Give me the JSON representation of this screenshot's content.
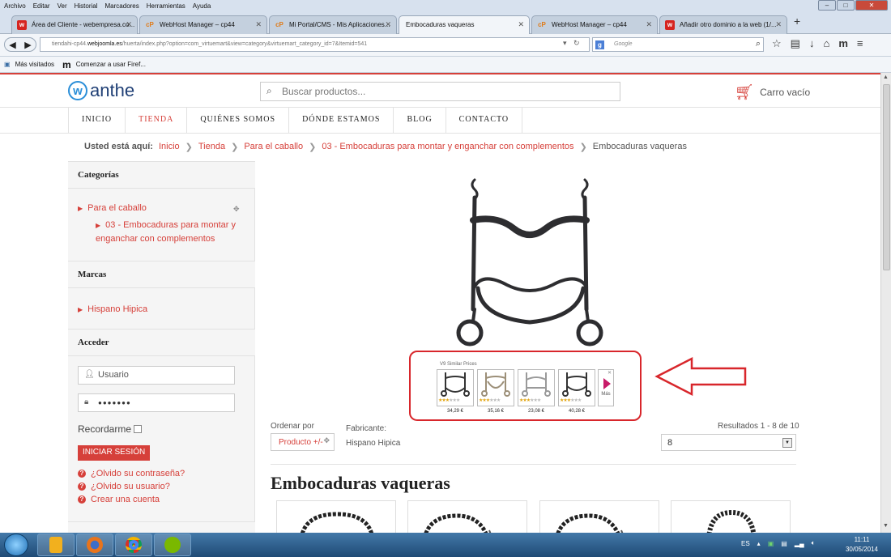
{
  "browser": {
    "menu": [
      "Archivo",
      "Editar",
      "Ver",
      "Historial",
      "Marcadores",
      "Herramientas",
      "Ayuda"
    ],
    "tabs": [
      {
        "label": "Área del Cliente - webempresa.co...",
        "icon": "webempresa-icon",
        "fav": "w"
      },
      {
        "label": "WebHost Manager – cp44",
        "icon": "cpanel-icon",
        "fav": "cP"
      },
      {
        "label": "Mi Portal/CMS - Mis Aplicaciones...",
        "icon": "cpanel-icon",
        "fav": "cP"
      },
      {
        "label": "Embocaduras vaqueras",
        "icon": "",
        "fav": ""
      },
      {
        "label": "WebHost Manager – cp44",
        "icon": "cpanel-icon",
        "fav": "cP"
      },
      {
        "label": "Añadir otro dominio a la web (1/...",
        "icon": "webempresa-icon",
        "fav": "w"
      }
    ],
    "url_prefix": "tiendahi-cp44.",
    "url_domain": "webjoomla.es",
    "url_rest": "/huerta/index.php?option=com_virtuemart&view=category&virtuemart_category_id=7&Itemid=541",
    "search_engine": "Google",
    "search_placeholder": "Google",
    "bookmarks": [
      "Más visitados",
      "Comenzar a usar Firef..."
    ]
  },
  "site": {
    "logo_text": "anthe",
    "search_placeholder": "Buscar productos...",
    "cart_label": "Carro vacío",
    "nav": [
      "INICIO",
      "TIENDA",
      "QUIÉNES SOMOS",
      "DÓNDE ESTAMOS",
      "BLOG",
      "CONTACTO"
    ],
    "nav_current": "TIENDA",
    "accent_color": "#d6403a"
  },
  "breadcrumb": {
    "label": "Usted está aquí:",
    "items": [
      "Inicio",
      "Tienda",
      "Para el caballo",
      "03 - Embocaduras para montar y enganchar con complementos"
    ],
    "current": "Embocaduras vaqueras"
  },
  "sidebar": {
    "categories_title": "Categorías",
    "category_parent": "Para el caballo",
    "category_child": "03 - Embocaduras para montar y enganchar con complementos",
    "brands_title": "Marcas",
    "brand": "Hispano Hipica",
    "login_title": "Acceder",
    "username_placeholder": "Usuario",
    "password_value": "●●●●●●●",
    "remember_label": "Recordarme",
    "login_button": "INICIAR SESIÓN",
    "forgot_password": "¿Olvido su contraseña?",
    "forgot_user": "¿Olvido su usuario?",
    "create_account": "Crear una cuenta"
  },
  "similar_prices": {
    "title": "V9 Similar Prices",
    "items": [
      {
        "price": "34,29 €",
        "rating": 3
      },
      {
        "price": "35,16 €",
        "rating": 3
      },
      {
        "price": "23,08 €",
        "rating": 3
      },
      {
        "price": "40,28 €",
        "rating": 3
      }
    ],
    "more_label": "Más"
  },
  "listing": {
    "order_label": "Ordenar por",
    "order_value": "Producto +/-",
    "manufacturer_label": "Fabricante:",
    "manufacturer_value": "Hispano Hipica",
    "results_label": "Resultados 1 - 8 de 10",
    "per_page_value": "8",
    "page_title": "Embocaduras vaqueras"
  },
  "taskbar": {
    "lang": "ES",
    "time": "11:11",
    "date": "30/05/2014"
  }
}
